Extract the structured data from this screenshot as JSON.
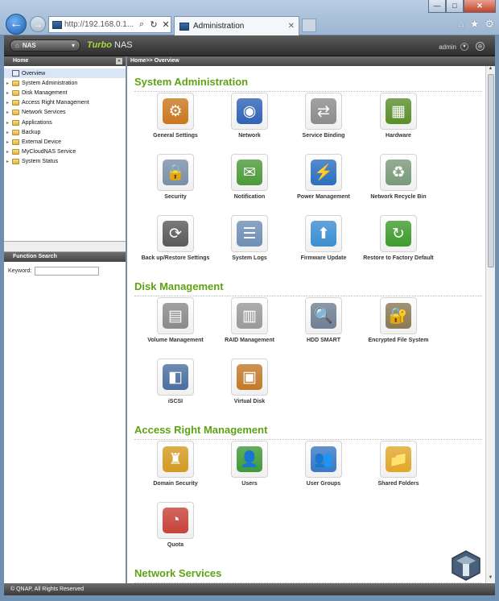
{
  "browser": {
    "url": "http://192.168.0.1...",
    "tab_title": "Administration",
    "window_buttons": {
      "min": "—",
      "max": "□",
      "close": "✕"
    }
  },
  "nas_header": {
    "selector_label": "NAS",
    "brand": "Turbo",
    "brand_suffix": "NAS",
    "user": "admin"
  },
  "sidebar": {
    "header": "Home",
    "items": [
      {
        "label": "Overview",
        "icon": "overview-icon",
        "selected": true
      },
      {
        "label": "System Administration",
        "icon": "folder-icon"
      },
      {
        "label": "Disk Management",
        "icon": "folder-icon"
      },
      {
        "label": "Access Right Management",
        "icon": "folder-icon"
      },
      {
        "label": "Network Services",
        "icon": "folder-icon"
      },
      {
        "label": "Applications",
        "icon": "folder-icon"
      },
      {
        "label": "Backup",
        "icon": "folder-icon"
      },
      {
        "label": "External Device",
        "icon": "folder-icon"
      },
      {
        "label": "MyCloudNAS Service",
        "icon": "folder-icon"
      },
      {
        "label": "System Status",
        "icon": "folder-icon"
      }
    ]
  },
  "function_search": {
    "header": "Function Search",
    "keyword_label": "Keyword:",
    "keyword_value": ""
  },
  "breadcrumb": "Home>> Overview",
  "sections": [
    {
      "title": "System Administration",
      "items": [
        {
          "label": "General Settings",
          "icon": "general-settings-icon",
          "color": "#c9781e",
          "glyph": "⚙"
        },
        {
          "label": "Network",
          "icon": "network-icon",
          "color": "#2f63b6",
          "glyph": "◉"
        },
        {
          "label": "Service Binding",
          "icon": "service-binding-icon",
          "color": "#8c8c8c",
          "glyph": "⇄"
        },
        {
          "label": "Hardware",
          "icon": "hardware-icon",
          "color": "#5a8f2a",
          "glyph": "▦"
        },
        {
          "label": "Security",
          "icon": "security-icon",
          "color": "#7a8fa8",
          "glyph": "🔒"
        },
        {
          "label": "Notification",
          "icon": "notification-icon",
          "color": "#4d9a3a",
          "glyph": "✉"
        },
        {
          "label": "Power Management",
          "icon": "power-management-icon",
          "color": "#2b6fbf",
          "glyph": "⚡"
        },
        {
          "label": "Network Recycle Bin",
          "icon": "recycle-bin-icon",
          "color": "#7a9a7a",
          "glyph": "♻"
        },
        {
          "label": "Back up/Restore Settings",
          "icon": "backup-restore-icon",
          "color": "#5a5a5a",
          "glyph": "⟳"
        },
        {
          "label": "System Logs",
          "icon": "system-logs-icon",
          "color": "#6f8fb5",
          "glyph": "☰"
        },
        {
          "label": "Firmware Update",
          "icon": "firmware-update-icon",
          "color": "#3c8ed1",
          "glyph": "⬆"
        },
        {
          "label": "Restore to Factory Default",
          "icon": "restore-factory-icon",
          "color": "#3e9c2e",
          "glyph": "↻"
        }
      ]
    },
    {
      "title": "Disk Management",
      "items": [
        {
          "label": "Volume Management",
          "icon": "volume-management-icon",
          "color": "#8a8a8a",
          "glyph": "▤"
        },
        {
          "label": "RAID Management",
          "icon": "raid-management-icon",
          "color": "#9a9a9a",
          "glyph": "▥"
        },
        {
          "label": "HDD SMART",
          "icon": "hdd-smart-icon",
          "color": "#6f7f95",
          "glyph": "🔍"
        },
        {
          "label": "Encrypted File System",
          "icon": "encrypted-fs-icon",
          "color": "#8a7a55",
          "glyph": "🔐"
        },
        {
          "label": "iSCSI",
          "icon": "iscsi-icon",
          "color": "#4a6fa0",
          "glyph": "◧"
        },
        {
          "label": "Virtual Disk",
          "icon": "virtual-disk-icon",
          "color": "#c27a2a",
          "glyph": "▣"
        }
      ]
    },
    {
      "title": "Access Right Management",
      "items": [
        {
          "label": "Domain Security",
          "icon": "domain-security-icon",
          "color": "#d49a22",
          "glyph": "♜"
        },
        {
          "label": "Users",
          "icon": "users-icon",
          "color": "#3f9a3a",
          "glyph": "👤"
        },
        {
          "label": "User Groups",
          "icon": "user-groups-icon",
          "color": "#3b78c4",
          "glyph": "👥"
        },
        {
          "label": "Shared Folders",
          "icon": "shared-folders-icon",
          "color": "#e0a82a",
          "glyph": "📁"
        },
        {
          "label": "Quota",
          "icon": "quota-icon",
          "color": "#c6433a",
          "glyph": "◔"
        }
      ]
    },
    {
      "title": "Network Services",
      "items": []
    }
  ],
  "footer": "© QNAP, All Rights Reserved"
}
